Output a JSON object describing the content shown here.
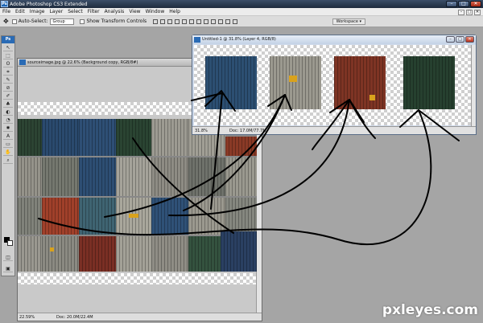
{
  "app": {
    "title": "Adobe Photoshop CS3 Extended",
    "badge": "Ps",
    "window_buttons": [
      "–",
      "□",
      "✕"
    ]
  },
  "menu": {
    "items": [
      "File",
      "Edit",
      "Image",
      "Layer",
      "Select",
      "Filter",
      "Analysis",
      "View",
      "Window",
      "Help"
    ],
    "right_buttons": [
      "–",
      "□",
      "✕"
    ]
  },
  "options": {
    "auto_select_label": "Auto-Select:",
    "auto_select_value": "Group",
    "transform_label": "Show Transform Controls",
    "workspace_label": "Workspace ▾"
  },
  "toolbox": {
    "badge": "Ps",
    "tools": [
      "↖",
      "⬚",
      "ʘ",
      "⌗",
      "✎",
      "⊘",
      "✐",
      "♣",
      "◐",
      "◔",
      "✸",
      "A",
      "▭",
      "✋",
      "⌕"
    ]
  },
  "source_doc": {
    "title": "sourceimage.jpg @ 22.6% (Background copy, RGB/8#)",
    "zoom": "22.59%",
    "doc_info": "Doc: 20.0M/22.4M"
  },
  "untitled_doc": {
    "title": "Untitled-1 @ 31.8% (Layer 4, RGB/8)",
    "zoom": "31.8%",
    "doc_info": "Doc: 17.0M/77.7M",
    "buttons": [
      "–",
      "□",
      "✕"
    ]
  },
  "colors": {
    "blue_container": "#2c4f72",
    "grey_container": "#9b998f",
    "red_container": "#7e3424",
    "green_container": "#26402f"
  },
  "watermark": "pxleyes.com"
}
